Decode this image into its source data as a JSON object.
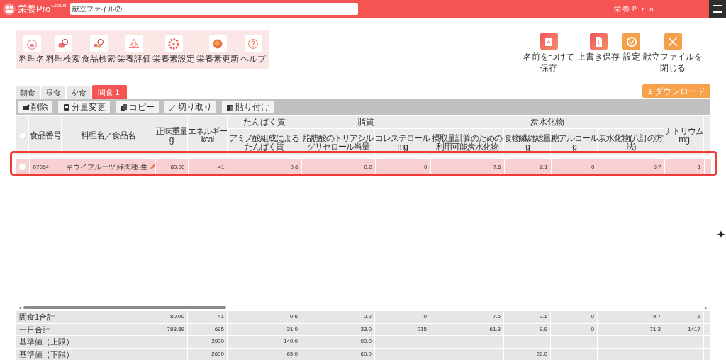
{
  "header": {
    "logo": "栄養Pro",
    "logo_sup": "Cloud",
    "file_name": "献立ファイル②",
    "app_name": "栄養Ｐｒｏ"
  },
  "tools": [
    {
      "label": "料理名"
    },
    {
      "label": "料理検索"
    },
    {
      "label": "食品検索"
    },
    {
      "label": "栄養評価"
    },
    {
      "label": "栄養素設定"
    },
    {
      "label": "栄養素更新"
    },
    {
      "label": "ヘルプ"
    }
  ],
  "actions": [
    {
      "lines": [
        "名前をつけて",
        "保存"
      ]
    },
    {
      "lines": [
        "上書き保存"
      ]
    },
    {
      "lines": [
        "設定"
      ]
    },
    {
      "lines": [
        "献立ファイルを",
        "閉じる"
      ]
    }
  ],
  "tabs": [
    {
      "label": "朝食",
      "selected": false
    },
    {
      "label": "昼食",
      "selected": false
    },
    {
      "label": "夕食",
      "selected": false
    },
    {
      "label": "間食１",
      "selected": true
    }
  ],
  "download_button": "ダウンロード",
  "edit_buttons": [
    "削除",
    "分量変更",
    "コピー",
    "切り取り",
    "貼り付け"
  ],
  "table": {
    "all_selected": false,
    "columns": [
      {
        "lines": [
          "食品番号"
        ]
      },
      {
        "lines": [
          "料理名／食品名"
        ]
      },
      {
        "lines": [
          "正味重量"
        ],
        "unit": "g"
      },
      {
        "lines": [
          "エネルギー"
        ],
        "unit": "kcal"
      },
      {
        "group": "たんぱく質",
        "columns": [
          {
            "lines": [
              "アミノ酸組成による",
              "たんぱく質"
            ]
          }
        ]
      },
      {
        "group": "脂質",
        "columns": [
          {
            "lines": [
              "脂肪酸のトリアシル",
              "グリセロール当量"
            ]
          },
          {
            "lines": [
              "コレステロール"
            ],
            "unit": "mg"
          }
        ]
      },
      {
        "group": "炭水化物",
        "columns": [
          {
            "lines": [
              "摂取量計算のための",
              "利用可能炭水化物"
            ]
          },
          {
            "lines": [
              "食物繊維総量"
            ],
            "unit": "g"
          },
          {
            "lines": [
              "糖アルコール"
            ],
            "unit": "g"
          },
          {
            "lines": [
              "炭水化物(八訂の方",
              "法)"
            ]
          }
        ]
      },
      {
        "lines": [
          "ナトリウム"
        ],
        "unit": "mg"
      }
    ],
    "rows": [
      {
        "selected": false,
        "highlighted": true,
        "code": "07054",
        "name": "キウイフルーツ 緑肉種 生",
        "values": [
          "80.00",
          "41",
          "0.6",
          "0.2",
          "0",
          "7.6",
          "2.1",
          "0",
          "9.7",
          "1"
        ]
      }
    ],
    "totals": [
      {
        "label": "間食1合計",
        "cells": [
          {
            "text": "80.00"
          },
          {
            "text": "41"
          },
          {
            "text": "0.6"
          },
          {
            "text": "0.2"
          },
          {
            "text": "0"
          },
          {
            "text": "7.6"
          },
          {
            "text": "2.1"
          },
          {
            "text": "0"
          },
          {
            "text": "9.7"
          },
          {
            "text": "1"
          }
        ]
      },
      {
        "label": "一日合計",
        "cells": [
          {
            "text": "788.89"
          },
          {
            "text": "695"
          },
          {
            "text": "31.0"
          },
          {
            "text": "33.0"
          },
          {
            "text": "215"
          },
          {
            "text": "61.3"
          },
          {
            "text": "9.9"
          },
          {
            "text": "0"
          },
          {
            "text": "71.3"
          },
          {
            "text": "1417"
          }
        ]
      },
      {
        "label": "基準値（上限）",
        "cells": [
          {
            "empty": true
          },
          {
            "text": "2900"
          },
          {
            "text": "140.0"
          },
          {
            "text": "90.0"
          },
          {
            "empty": true
          },
          {
            "empty": true
          },
          {
            "empty": true
          },
          {
            "empty": true
          },
          {
            "empty": true
          },
          {
            "empty": true
          }
        ]
      },
      {
        "label": "基準値（下限）",
        "cells": [
          {
            "empty": true
          },
          {
            "text": "2600"
          },
          {
            "text": "65.0"
          },
          {
            "text": "60.0"
          },
          {
            "empty": true
          },
          {
            "empty": true
          },
          {
            "text": "22.0"
          },
          {
            "empty": true
          },
          {
            "empty": true
          },
          {
            "empty": true
          }
        ]
      }
    ]
  }
}
